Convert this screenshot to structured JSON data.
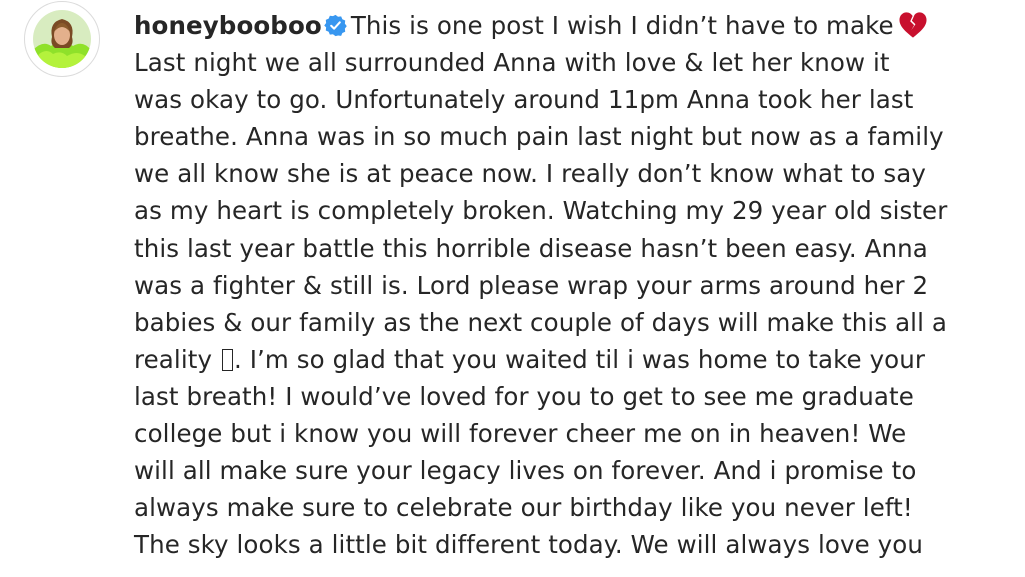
{
  "post": {
    "username": "honeybooboo",
    "verified_icon": "verified-badge-icon",
    "verified_color": "#3897f0",
    "heart_icon": "broken-heart-icon",
    "heart_color": "#c8102e",
    "lines": [
      "This is one post I wish I didn’t have to make",
      "Last night we all surrounded Anna with love & let her know it",
      "was okay to go. Unfortunately around 11pm Anna took her last",
      "breathe. Anna was in so much pain last night but now as a family",
      "we all know she is at peace now. I really don’t know what to say",
      "as my heart is completely broken. Watching my 29 year old sister",
      "this last year battle this horrible disease hasn’t been easy. Anna",
      "was a fighter & still is. Lord please wrap your arms around her 2",
      "babies & our family as the next couple of days will make this all a",
      "reality",
      ". I’m so glad that you waited til i was home to take your",
      "last breath! I would’ve loved for you to get to see me graduate",
      "college but i know you will forever cheer me on in heaven! We",
      "will all make sure your legacy lives on forever. And i promise to",
      "always make sure to celebrate our birthday like you never left!",
      "The sky looks a little bit different today. We will always love you"
    ]
  }
}
